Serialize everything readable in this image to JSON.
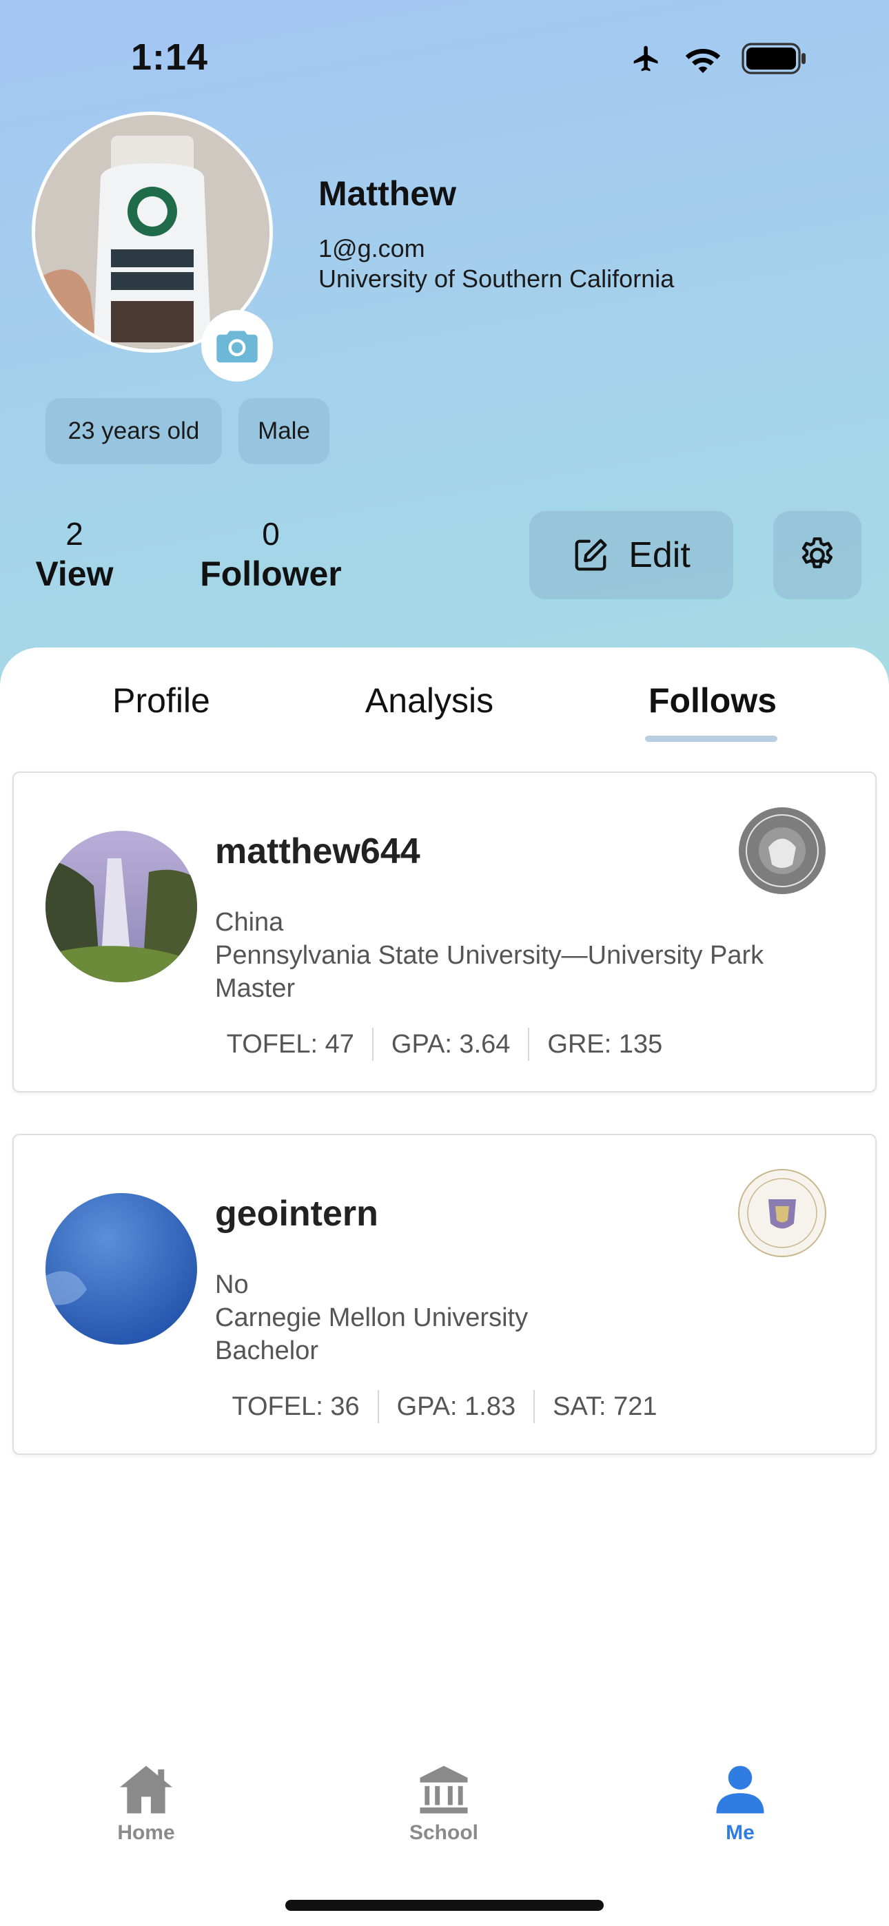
{
  "status_bar": {
    "time": "1:14",
    "icons": [
      "airplane-icon",
      "wifi-icon",
      "battery-icon"
    ]
  },
  "profile": {
    "name": "Matthew",
    "email": "1@g.com",
    "school": "University of Southern California",
    "age_chip": "23 years old",
    "gender_chip": "Male"
  },
  "stats": {
    "views": {
      "value": "2",
      "label": "View"
    },
    "followers": {
      "value": "0",
      "label": "Follower"
    }
  },
  "actions": {
    "edit_label": "Edit"
  },
  "tabs": [
    {
      "label": "Profile",
      "active": false
    },
    {
      "label": "Analysis",
      "active": false
    },
    {
      "label": "Follows",
      "active": true
    }
  ],
  "follows": [
    {
      "username": "matthew644",
      "country": "China",
      "school": "Pennsylvania State University—University Park",
      "degree": "Master",
      "scores": [
        "TOFEL: 47",
        "GPA: 3.64",
        "GRE: 135"
      ]
    },
    {
      "username": "geointern",
      "country": "No",
      "school": "Carnegie Mellon University",
      "degree": "Bachelor",
      "scores": [
        "TOFEL: 36",
        "GPA: 1.83",
        "SAT: 721"
      ]
    }
  ],
  "bottom_nav": [
    {
      "label": "Home",
      "icon": "home-icon",
      "active": false
    },
    {
      "label": "School",
      "icon": "school-icon",
      "active": false
    },
    {
      "label": "Me",
      "icon": "person-icon",
      "active": true
    }
  ],
  "colors": {
    "accent": "#2f7de2",
    "inactive": "#8a8a8a"
  }
}
